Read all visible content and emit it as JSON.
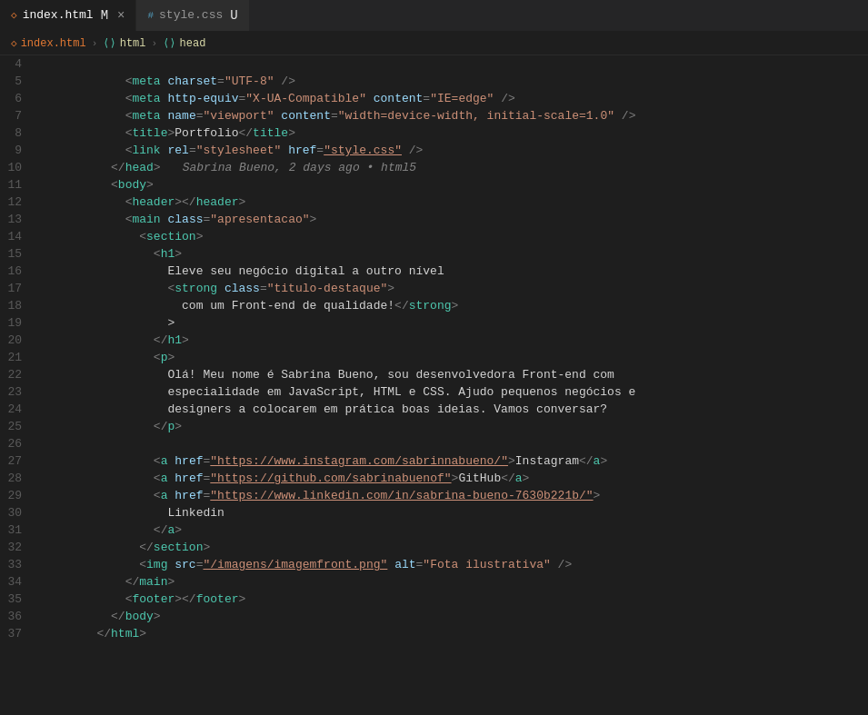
{
  "tabs": [
    {
      "id": "index-html",
      "label": "index.html",
      "icon": "html-icon",
      "icon_char": "◇",
      "modified": true,
      "active": true,
      "badge": "M"
    },
    {
      "id": "style-css",
      "label": "style.css",
      "icon": "css-icon",
      "icon_char": "#",
      "modified": true,
      "active": false,
      "badge": "U"
    }
  ],
  "breadcrumb": {
    "file": "index.html",
    "path": [
      "html",
      "head"
    ]
  },
  "git_annotation": {
    "author": "Sabrina Bueno",
    "time": "2 days ago",
    "message": "html5"
  },
  "lines": [
    {
      "num": 4,
      "content": "    <meta charset=\"UTF-8\" />"
    },
    {
      "num": 5,
      "content": "    <meta http-equiv=\"X-UA-Compatible\" content=\"IE=edge\" />"
    },
    {
      "num": 6,
      "content": "    <meta name=\"viewport\" content=\"width=device-width, initial-scale=1.0\" />"
    },
    {
      "num": 7,
      "content": "    <title>Portfolio</title>"
    },
    {
      "num": 8,
      "content": "    <link rel=\"stylesheet\" href=\"style.css\" />"
    },
    {
      "num": 9,
      "content": "  </head>"
    },
    {
      "num": 10,
      "content": "  <body>"
    },
    {
      "num": 11,
      "content": "    <header></header>"
    },
    {
      "num": 12,
      "content": "    <main class=\"apresentacao\">"
    },
    {
      "num": 13,
      "content": "      <section>"
    },
    {
      "num": 14,
      "content": "        <h1>"
    },
    {
      "num": 15,
      "content": "          Eleve seu negócio digital a outro nível"
    },
    {
      "num": 16,
      "content": "          <strong class=\"titulo-destaque\">"
    },
    {
      "num": 17,
      "content": "            com um Front-end de qualidade!</strong>"
    },
    {
      "num": 18,
      "content": "          >"
    },
    {
      "num": 19,
      "content": "        </h1>"
    },
    {
      "num": 20,
      "content": "        <p>"
    },
    {
      "num": 21,
      "content": "          Olá! Meu nome é Sabrina Bueno, sou desenvolvedora Front-end com"
    },
    {
      "num": 22,
      "content": "          especialidade em JavaScript, HTML e CSS. Ajudo pequenos negócios e"
    },
    {
      "num": 23,
      "content": "          designers a colocarem em prática boas ideias. Vamos conversar?"
    },
    {
      "num": 24,
      "content": "        </p>"
    },
    {
      "num": 25,
      "content": ""
    },
    {
      "num": 26,
      "content": "        <a href=\"https://www.instagram.com/sabrinnabueno/\">Instagram</a>"
    },
    {
      "num": 27,
      "content": "        <a href=\"https://github.com/sabrinabuenof\">GitHub</a>"
    },
    {
      "num": 28,
      "content": "        <a href=\"https://www.linkedin.com/in/sabrina-bueno-7630b221b/\">"
    },
    {
      "num": 29,
      "content": "          Linkedin"
    },
    {
      "num": 30,
      "content": "        </a>"
    },
    {
      "num": 31,
      "content": "      </section>"
    },
    {
      "num": 32,
      "content": "      <img src=\"/imagens/imagemfront.png\" alt=\"Fota ilustrativa\" />"
    },
    {
      "num": 33,
      "content": "    </main>"
    },
    {
      "num": 34,
      "content": "    <footer></footer>"
    },
    {
      "num": 35,
      "content": "  </body>"
    },
    {
      "num": 36,
      "content": "</html>"
    },
    {
      "num": 37,
      "content": ""
    }
  ]
}
